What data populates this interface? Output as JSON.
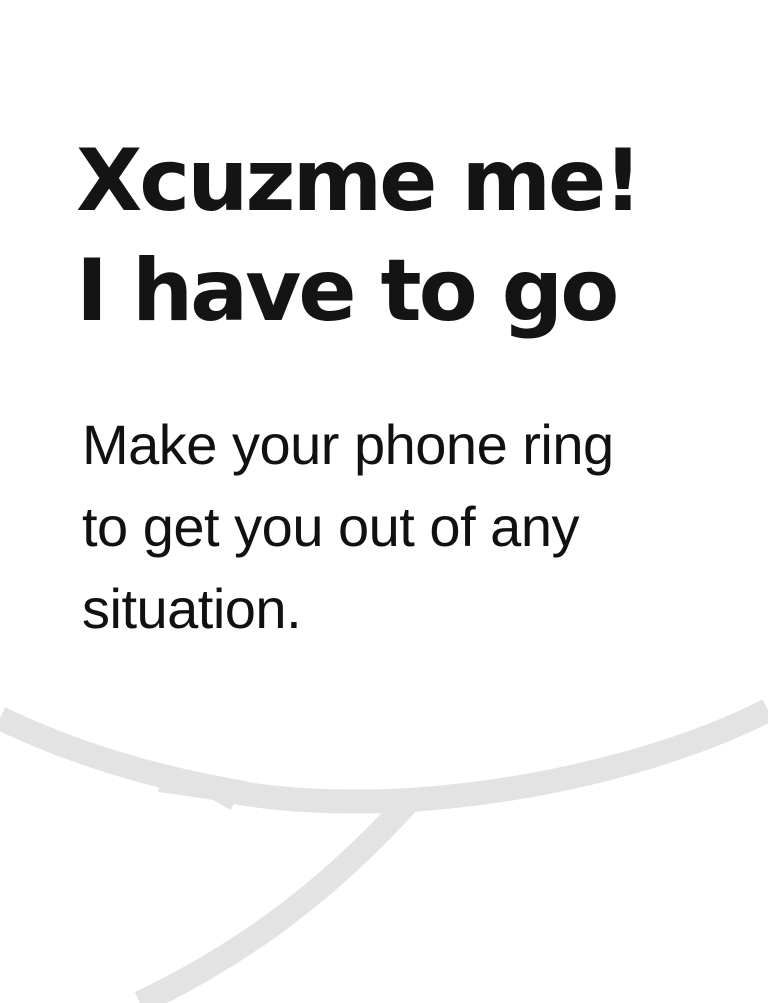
{
  "headline": {
    "line1": "Xcuzme me!",
    "line2": "I have to go"
  },
  "subtitle": {
    "line1": "Make your phone ring",
    "line2": "to get you out of any",
    "line3": "situation."
  },
  "colors": {
    "background": "#ffffff",
    "text": "#141414",
    "bubble_outline": "#e3e3e3"
  }
}
